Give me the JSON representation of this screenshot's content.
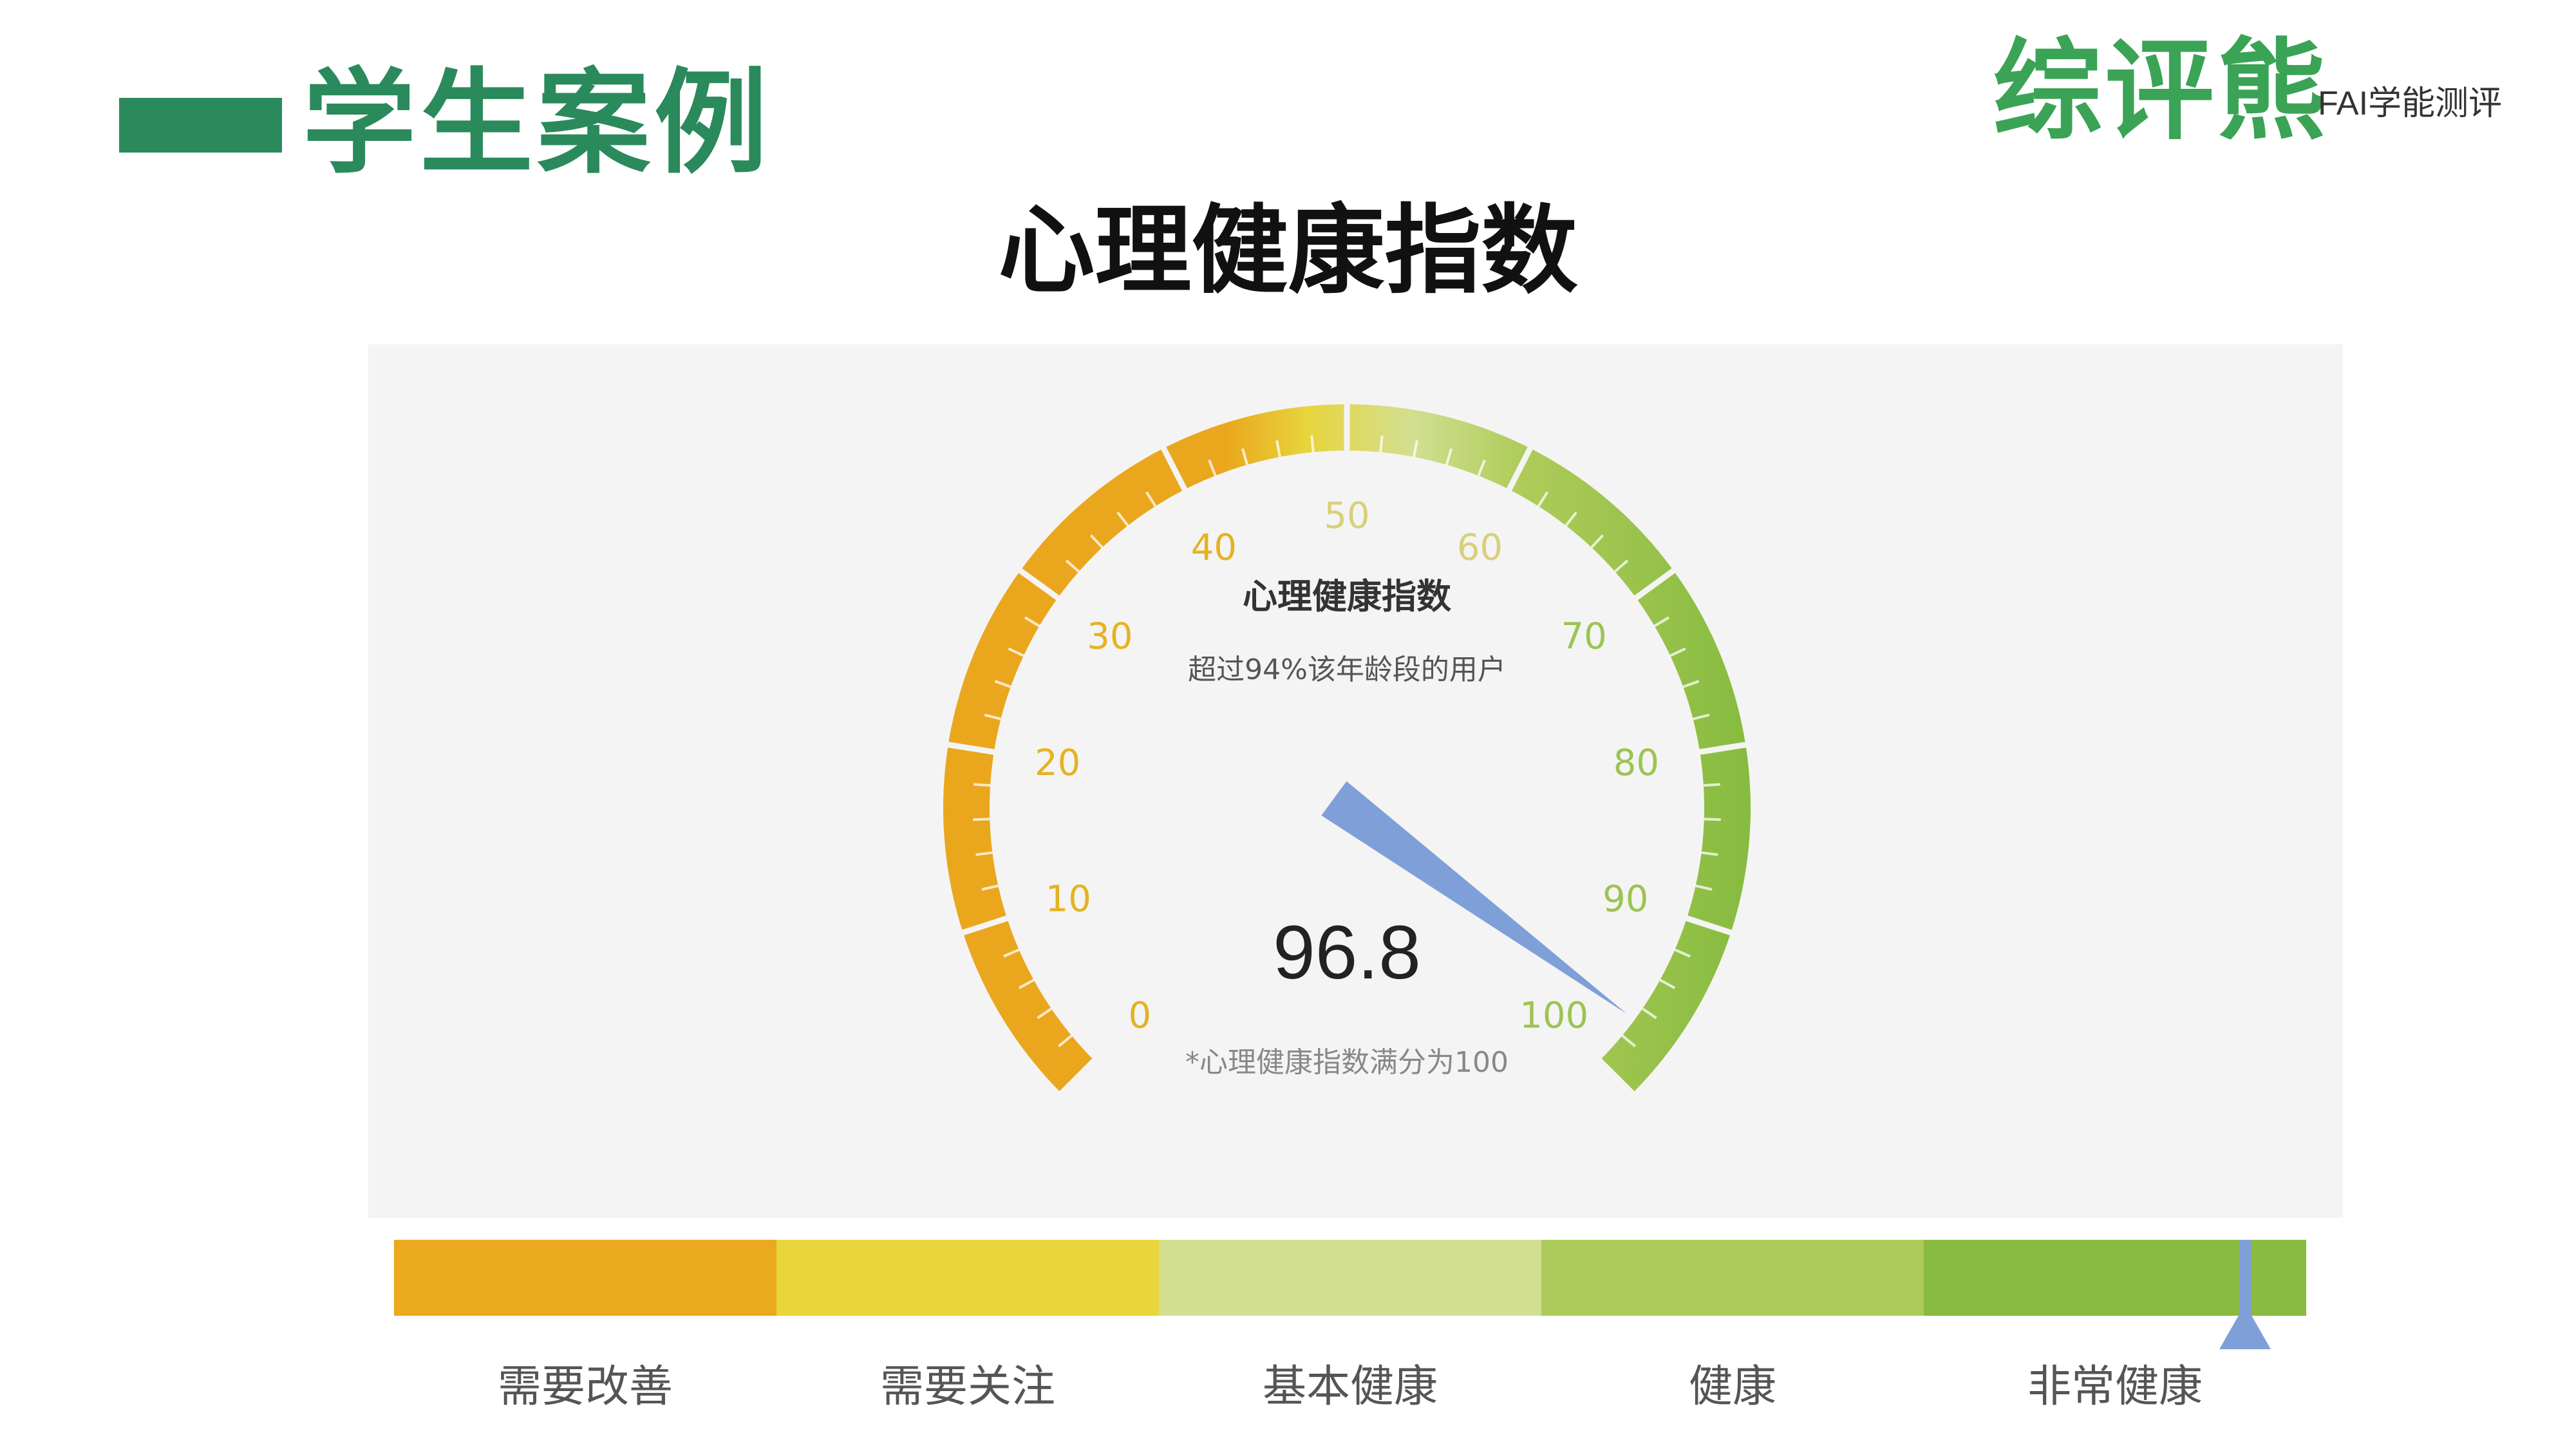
{
  "header": {
    "section_title": "学生案例",
    "logo_text": "综评熊",
    "logo_subtitle": "FAI学能测评"
  },
  "page_title": "心理健康指数",
  "gauge": {
    "title": "心理健康指数",
    "subtitle": "超过94%该年龄段的用户",
    "value_text": "96.8",
    "value": 96.8,
    "min": 0,
    "max": 100,
    "tick_labels": [
      "0",
      "10",
      "20",
      "30",
      "40",
      "50",
      "60",
      "70",
      "80",
      "90",
      "100"
    ],
    "footnote": "*心理健康指数满分为100",
    "needle_color": "#7f9fd8",
    "colors": {
      "orange": "#eaa71e",
      "yellow": "#e8d43c",
      "pale_green": "#d2df91",
      "light_green": "#aecb59",
      "green": "#86bb3f"
    }
  },
  "scale": {
    "levels": [
      {
        "label": "需要改善",
        "color": "#eaa91f"
      },
      {
        "label": "需要关注",
        "color": "#e9d53c"
      },
      {
        "label": "基本健康",
        "color": "#d2df91"
      },
      {
        "label": "健康",
        "color": "#adcb5a"
      },
      {
        "label": "非常健康",
        "color": "#88bb40"
      }
    ],
    "marker_value": 96.8,
    "marker_color": "#7f9fd8"
  }
}
